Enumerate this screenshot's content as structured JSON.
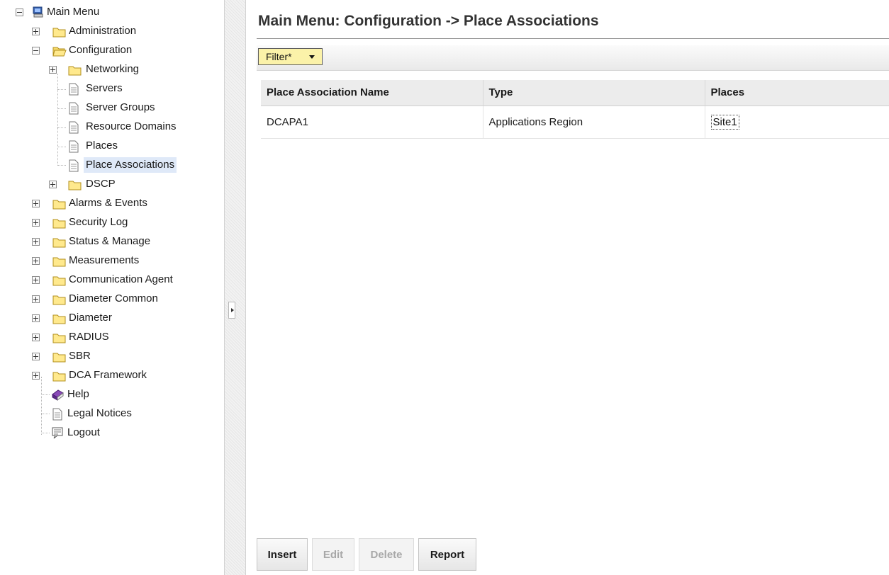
{
  "nav": {
    "root": "Main Menu",
    "items": {
      "administration": "Administration",
      "configuration": "Configuration",
      "networking": "Networking",
      "servers": "Servers",
      "server_groups": "Server Groups",
      "resource_domains": "Resource Domains",
      "places": "Places",
      "place_associations": "Place Associations",
      "dscp": "DSCP",
      "alarms_events": "Alarms & Events",
      "security_log": "Security Log",
      "status_manage": "Status & Manage",
      "measurements": "Measurements",
      "communication_agent": "Communication Agent",
      "diameter_common": "Diameter Common",
      "diameter": "Diameter",
      "radius": "RADIUS",
      "sbr": "SBR",
      "dca_framework": "DCA Framework",
      "help": "Help",
      "legal_notices": "Legal Notices",
      "logout": "Logout"
    },
    "selected": "Place Associations"
  },
  "page": {
    "title": "Main Menu: Configuration -> Place Associations",
    "filter_label": "Filter*"
  },
  "table": {
    "columns": [
      "Place Association Name",
      "Type",
      "Places"
    ],
    "rows": [
      {
        "name": "DCAPA1",
        "type": "Applications Region",
        "places": "Site1"
      }
    ]
  },
  "actions": {
    "insert": "Insert",
    "edit": "Edit",
    "delete": "Delete",
    "report": "Report"
  },
  "colors": {
    "filter_button": "#fbf2a9",
    "selected_item": "#dfe9f8",
    "folder": "#ffe98d"
  },
  "icons": {
    "root": "computer-icon",
    "folder": "folder-icon",
    "open_folder": "folder-open-icon",
    "page": "page-icon",
    "help": "help-book-icon",
    "logout": "logout-icon",
    "expand": "plus-box-icon",
    "collapse": "minus-box-icon"
  }
}
